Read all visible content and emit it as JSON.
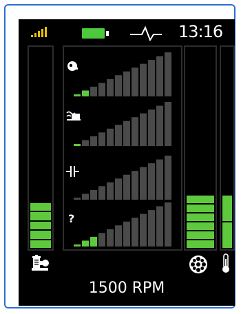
{
  "status_bar": {
    "time": "13:16",
    "signal_level": 5,
    "battery_fraction": 1.0,
    "signal_icon": "signal-bars-icon",
    "battery_icon": "battery-icon",
    "pulse_icon": "heartbeat-pulse-icon"
  },
  "left_gauge": {
    "icon": "motor-pump-icon",
    "level_fraction": 0.22,
    "segments_lit": 5,
    "color": "#5fc93e"
  },
  "right_gauge": {
    "icon": "fan-wheel-icon",
    "level_fraction": 0.26,
    "segments_lit": 6,
    "color": "#5fc93e"
  },
  "temperature_gauge": {
    "icon": "thermometer-icon",
    "level_fraction": 0.26,
    "color": "#5fc93e"
  },
  "rows": [
    {
      "icon": "speed-knob-icon",
      "glyph": "",
      "total_bars": 12,
      "lit_bars": 2
    },
    {
      "icon": "water-level-icon",
      "glyph": "",
      "total_bars": 12,
      "lit_bars": 1
    },
    {
      "icon": "capacitor-icon",
      "glyph": "",
      "total_bars": 12,
      "lit_bars": 0
    },
    {
      "icon": "unknown-question-icon",
      "glyph": "?",
      "total_bars": 12,
      "lit_bars": 3
    }
  ],
  "colors": {
    "lit": "#5fc93e",
    "unlit": "#4a4a4a",
    "accent": "#2a6fd0",
    "battery": "#4cc93c",
    "signal": "#e8c400"
  },
  "footer": {
    "rpm_label": "1500 RPM"
  }
}
